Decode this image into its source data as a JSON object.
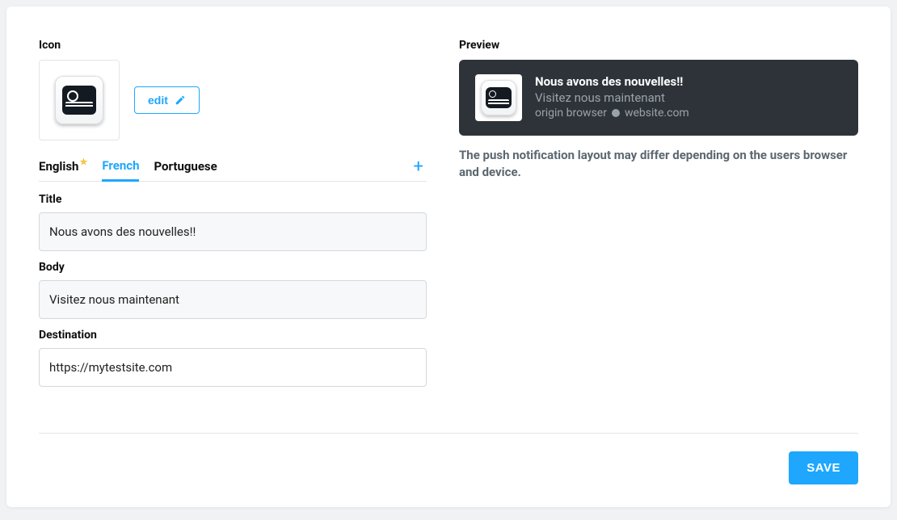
{
  "icon": {
    "label": "Icon",
    "edit_label": "edit"
  },
  "tabs": {
    "items": [
      {
        "label": "English",
        "default": true,
        "active": false
      },
      {
        "label": "French",
        "default": false,
        "active": true
      },
      {
        "label": "Portuguese",
        "default": false,
        "active": false
      }
    ]
  },
  "form": {
    "title_label": "Title",
    "title_value": "Nous avons des nouvelles!!",
    "body_label": "Body",
    "body_value": "Visitez nous maintenant",
    "destination_label": "Destination",
    "destination_value": "https://mytestsite.com"
  },
  "preview": {
    "label": "Preview",
    "title": "Nous avons des nouvelles!!",
    "body": "Visitez nous maintenant",
    "origin_browser": "origin browser",
    "website": "website.com",
    "note": "The push notification layout may differ depending on the users browser and device."
  },
  "footer": {
    "save_label": "SAVE"
  }
}
